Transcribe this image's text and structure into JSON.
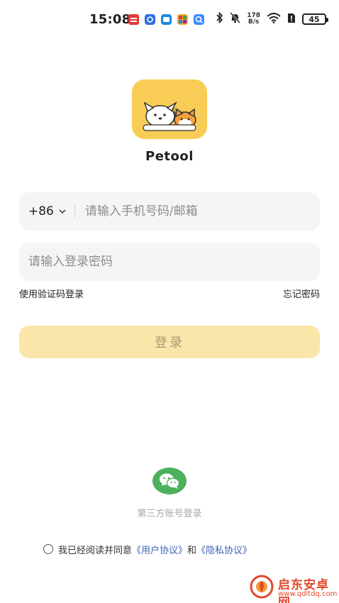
{
  "status_bar": {
    "time": "15:08",
    "net_speed_value": "178",
    "net_speed_unit": "B/s",
    "battery": "45"
  },
  "app": {
    "name": "Petool"
  },
  "form": {
    "country_code": "+86",
    "phone_placeholder": "请输入手机号码/邮箱",
    "password_placeholder": "请输入登录密码",
    "code_login_label": "使用验证码登录",
    "forgot_password_label": "忘记密码",
    "login_button_label": "登录"
  },
  "third_party": {
    "label": "第三方账号登录"
  },
  "agreement": {
    "prefix": "我已经阅读并同意",
    "user_agreement": "《用户协议》",
    "conjunction": "和",
    "privacy_policy": "《隐私协议》"
  },
  "watermark": {
    "title": "启东安卓网",
    "url": "www.qdltdq.com"
  },
  "colors": {
    "brand_yellow": "#f9cd55",
    "login_button_bg": "#fbe6a9",
    "wechat_green": "#4bb15a",
    "link_blue": "#3c64b7",
    "watermark_red": "#e1492e"
  }
}
